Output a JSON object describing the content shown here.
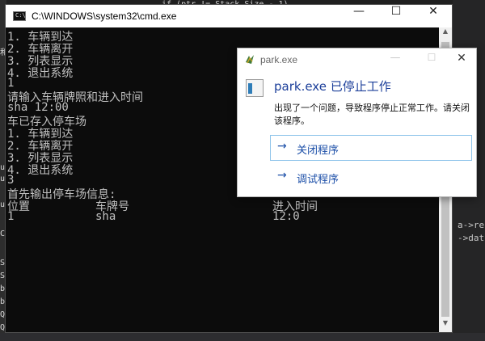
{
  "background": {
    "code_top": "if (ptr != Stack.Size - 1)",
    "left_fragments": [
      "和",
      "ue",
      "ue",
      "ue",
      "C",
      "St",
      "St",
      "b)",
      "b)",
      "Q",
      "Q"
    ],
    "right_fragments": [
      "ou",
      "a->re",
      "->dat"
    ]
  },
  "cmd": {
    "title": "C:\\WINDOWS\\system32\\cmd.exe",
    "icon_label": "C:\\",
    "minimize": "—",
    "maximize": "☐",
    "close": "✕",
    "lines": [
      "1. 车辆到达",
      "2. 车辆离开",
      "3. 列表显示",
      "4. 退出系统",
      "1",
      "请输入车辆牌照和进入时间",
      "sha 12:00",
      "车已存入停车场",
      "1. 车辆到达",
      "2. 车辆离开",
      "3. 列表显示",
      "4. 退出系统",
      "3",
      "首先输出停车场信息:"
    ],
    "table": {
      "headers": [
        "位置",
        "车牌号",
        "进入时间"
      ],
      "row": [
        "1",
        "sha",
        "12:0"
      ]
    }
  },
  "dialog": {
    "title": "park.exe",
    "heading": "park.exe 已停止工作",
    "message": "出现了一个问题，导致程序停止正常工作。请关闭该程序。",
    "options": [
      {
        "arrow": "→",
        "label": "关闭程序"
      },
      {
        "arrow": "→",
        "label": "调试程序"
      }
    ],
    "close": "✕",
    "minimize": "—",
    "maximize": "☐"
  }
}
